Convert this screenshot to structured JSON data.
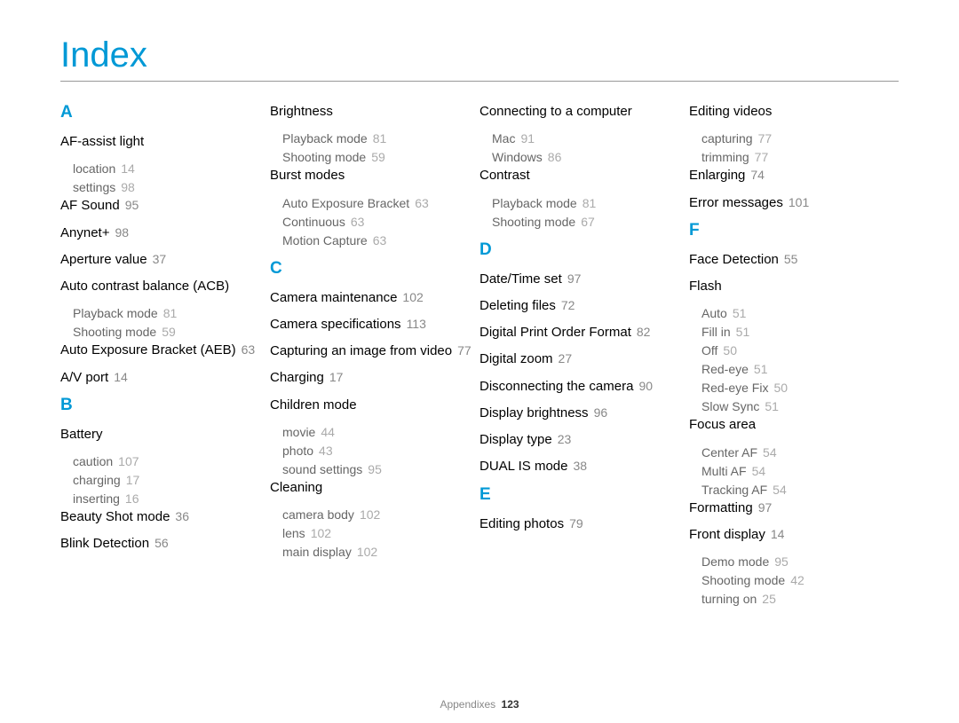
{
  "title": "Index",
  "footer": {
    "section": "Appendixes",
    "page": "123"
  },
  "columns": [
    {
      "groups": [
        {
          "letter": "A",
          "first": true,
          "entries": [
            {
              "label": "AF-assist light",
              "subs": [
                {
                  "label": "location",
                  "page": "14"
                },
                {
                  "label": "settings",
                  "page": "98"
                }
              ]
            },
            {
              "label": "AF Sound",
              "page": "95"
            },
            {
              "label": "Anynet+",
              "page": "98"
            },
            {
              "label": "Aperture value",
              "page": "37"
            },
            {
              "label": "Auto contrast balance (ACB)",
              "subs": [
                {
                  "label": "Playback mode",
                  "page": "81"
                },
                {
                  "label": "Shooting mode",
                  "page": "59"
                }
              ]
            },
            {
              "label": "Auto Exposure Bracket (AEB)",
              "page": "63"
            },
            {
              "label": "A/V port",
              "page": "14"
            }
          ]
        },
        {
          "letter": "B",
          "entries": [
            {
              "label": "Battery",
              "subs": [
                {
                  "label": "caution",
                  "page": "107"
                },
                {
                  "label": "charging",
                  "page": "17"
                },
                {
                  "label": "inserting",
                  "page": "16"
                }
              ]
            },
            {
              "label": "Beauty Shot mode",
              "page": "36"
            },
            {
              "label": "Blink Detection",
              "page": "56"
            }
          ]
        }
      ]
    },
    {
      "groups": [
        {
          "letter": null,
          "entries": [
            {
              "label": "Brightness",
              "subs": [
                {
                  "label": "Playback mode",
                  "page": "81"
                },
                {
                  "label": "Shooting mode",
                  "page": "59"
                }
              ]
            },
            {
              "label": "Burst modes",
              "subs": [
                {
                  "label": "Auto Exposure Bracket",
                  "page": "63"
                },
                {
                  "label": "Continuous",
                  "page": "63"
                },
                {
                  "label": "Motion Capture",
                  "page": "63"
                }
              ]
            }
          ]
        },
        {
          "letter": "C",
          "entries": [
            {
              "label": "Camera maintenance",
              "page": "102"
            },
            {
              "label": "Camera specifications",
              "page": "113"
            },
            {
              "label": "Capturing an image from video",
              "page": "77"
            },
            {
              "label": "Charging",
              "page": "17"
            },
            {
              "label": "Children mode",
              "subs": [
                {
                  "label": "movie",
                  "page": "44"
                },
                {
                  "label": "photo",
                  "page": "43"
                },
                {
                  "label": "sound settings",
                  "page": "95"
                }
              ]
            },
            {
              "label": "Cleaning",
              "subs": [
                {
                  "label": "camera body",
                  "page": "102"
                },
                {
                  "label": "lens",
                  "page": "102"
                },
                {
                  "label": "main display",
                  "page": "102"
                }
              ]
            }
          ]
        }
      ]
    },
    {
      "groups": [
        {
          "letter": null,
          "entries": [
            {
              "label": "Connecting to a computer",
              "subs": [
                {
                  "label": "Mac",
                  "page": "91"
                },
                {
                  "label": "Windows",
                  "page": "86"
                }
              ]
            },
            {
              "label": "Contrast",
              "subs": [
                {
                  "label": "Playback mode",
                  "page": "81"
                },
                {
                  "label": "Shooting mode",
                  "page": "67"
                }
              ]
            }
          ]
        },
        {
          "letter": "D",
          "entries": [
            {
              "label": "Date/Time set",
              "page": "97"
            },
            {
              "label": "Deleting files",
              "page": "72"
            },
            {
              "label": "Digital Print Order Format",
              "page": "82"
            },
            {
              "label": "Digital zoom",
              "page": "27"
            },
            {
              "label": "Disconnecting the camera",
              "page": "90"
            },
            {
              "label": "Display brightness",
              "page": "96"
            },
            {
              "label": "Display type",
              "page": "23"
            },
            {
              "label": "DUAL IS mode",
              "page": "38"
            }
          ]
        },
        {
          "letter": "E",
          "entries": [
            {
              "label": "Editing photos",
              "page": "79"
            }
          ]
        }
      ]
    },
    {
      "groups": [
        {
          "letter": null,
          "entries": [
            {
              "label": "Editing videos",
              "subs": [
                {
                  "label": "capturing",
                  "page": "77"
                },
                {
                  "label": "trimming",
                  "page": "77"
                }
              ]
            },
            {
              "label": "Enlarging",
              "page": "74"
            },
            {
              "label": "Error messages",
              "page": "101"
            }
          ]
        },
        {
          "letter": "F",
          "entries": [
            {
              "label": "Face Detection",
              "page": "55"
            },
            {
              "label": "Flash",
              "subs": [
                {
                  "label": "Auto",
                  "page": "51"
                },
                {
                  "label": "Fill in",
                  "page": "51"
                },
                {
                  "label": "Off",
                  "page": "50"
                },
                {
                  "label": "Red-eye",
                  "page": "51"
                },
                {
                  "label": "Red-eye Fix",
                  "page": "50"
                },
                {
                  "label": "Slow Sync",
                  "page": "51"
                }
              ]
            },
            {
              "label": "Focus area",
              "subs": [
                {
                  "label": "Center AF",
                  "page": "54"
                },
                {
                  "label": "Multi AF",
                  "page": "54"
                },
                {
                  "label": "Tracking AF",
                  "page": "54"
                }
              ]
            },
            {
              "label": "Formatting",
              "page": "97"
            },
            {
              "label": "Front display",
              "page": "14",
              "subs": [
                {
                  "label": "Demo mode",
                  "page": "95"
                },
                {
                  "label": "Shooting mode",
                  "page": "42"
                },
                {
                  "label": "turning on",
                  "page": "25"
                }
              ]
            }
          ]
        }
      ]
    }
  ]
}
